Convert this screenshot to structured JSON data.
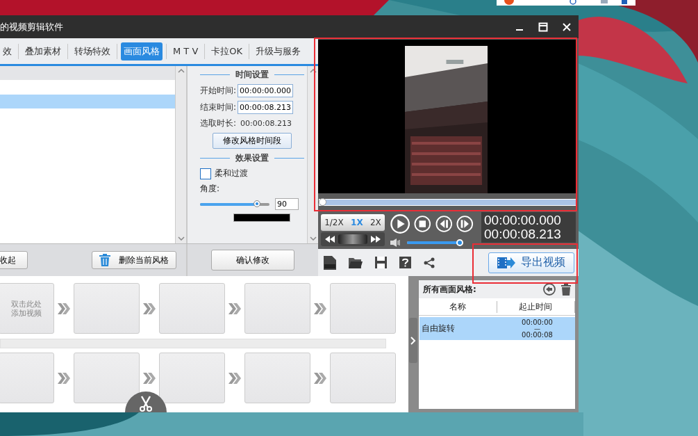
{
  "window": {
    "title": "的视频剪辑软件"
  },
  "tabs": [
    {
      "label": "效",
      "selected": false
    },
    {
      "label": "叠加素材",
      "selected": false
    },
    {
      "label": "转场特效",
      "selected": false
    },
    {
      "label": "画面风格",
      "selected": true
    },
    {
      "label": "M T V",
      "selected": false
    },
    {
      "label": "卡拉OK",
      "selected": false
    },
    {
      "label": "升级与服务",
      "selected": false
    }
  ],
  "style_list": {
    "rows": [
      {
        "selected": true
      }
    ],
    "collapse_button": "收起",
    "delete_button": "删除当前风格"
  },
  "time_settings": {
    "heading": "时间设置",
    "start_label": "开始时间:",
    "start_value": "00:00:00.000",
    "end_label": "结束时间:",
    "end_value": "00:00:08.213",
    "duration_label": "选取时长:",
    "duration_value": "00:00:08.213",
    "button": "修改风格时间段"
  },
  "effect_settings": {
    "heading": "效果设置",
    "soft_transition": {
      "label": "柔和过渡",
      "checked": false
    },
    "angle": {
      "label": "角度:",
      "value": "90"
    },
    "confirm_button": "确认修改"
  },
  "player": {
    "speeds": [
      {
        "label": "1/2X",
        "selected": false
      },
      {
        "label": "1X",
        "selected": true
      },
      {
        "label": "2X",
        "selected": false
      }
    ],
    "current_time": "00:00:00.000",
    "total_time": "00:00:08.213",
    "volume": {
      "level": 0.97
    }
  },
  "export_button": "导出视频",
  "storyboard": {
    "rows": [
      {
        "clips": [
          {
            "kind": "add",
            "hint_lines": [
              "双击此处",
              "添加视频"
            ]
          },
          {
            "kind": "empty"
          },
          {
            "kind": "empty"
          },
          {
            "kind": "empty"
          },
          {
            "kind": "empty"
          }
        ]
      },
      {
        "clips": [
          {
            "kind": "empty"
          },
          {
            "kind": "empty"
          },
          {
            "kind": "empty"
          },
          {
            "kind": "empty"
          },
          {
            "kind": "empty"
          }
        ]
      }
    ]
  },
  "style_panel": {
    "title": "所有画面风格:",
    "columns": [
      "名称",
      "起止时间"
    ],
    "rows": [
      {
        "name": "自由旋转",
        "start": "00:00:00",
        "separator": "—",
        "end": "00:00:08",
        "selected": true
      }
    ]
  }
}
